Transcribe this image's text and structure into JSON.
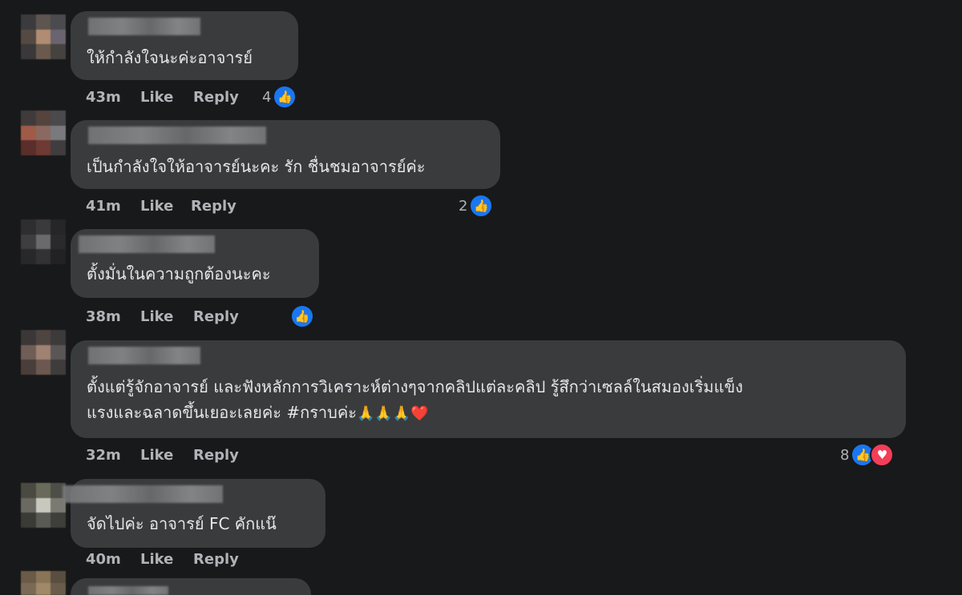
{
  "actions": {
    "like": "Like",
    "reply": "Reply"
  },
  "comments": [
    {
      "text": "ให้กำลังใจนะค่ะอาจารย์",
      "time": "43m",
      "reaction_count": "4"
    },
    {
      "text": "เป็นกำลังใจให้อาจารย์นะคะ รัก ชื่นชมอาจารย์ค่ะ",
      "time": "41m",
      "reaction_count": "2"
    },
    {
      "text": "ตั้งมั่นในความถูกต้องนะคะ",
      "time": "38m",
      "reaction_count": ""
    },
    {
      "text": "ตั้งแต่รู้จักอาจารย์ และฟังหลักการวิเคราะห์ต่างๆจากคลิปแต่ละคลิป รู้สึกว่าเซลล์ในสมองเริ่มแข็ง\nแรงและฉลาดขึ้นเยอะเลยค่ะ #กราบค่ะ",
      "emoji": "🙏🙏🙏❤️",
      "time": "32m",
      "reaction_count": "8"
    },
    {
      "text": "จัดไปค่ะ อาจารย์ FC คักแน๊",
      "time": "40m",
      "reaction_count": ""
    }
  ],
  "icons": {
    "like": "thumbs-up-icon",
    "love": "heart-icon"
  },
  "colors": {
    "background": "#18191a",
    "bubble": "#3a3b3c",
    "like_blue": "#1877f2",
    "love_red": "#f33e58"
  }
}
